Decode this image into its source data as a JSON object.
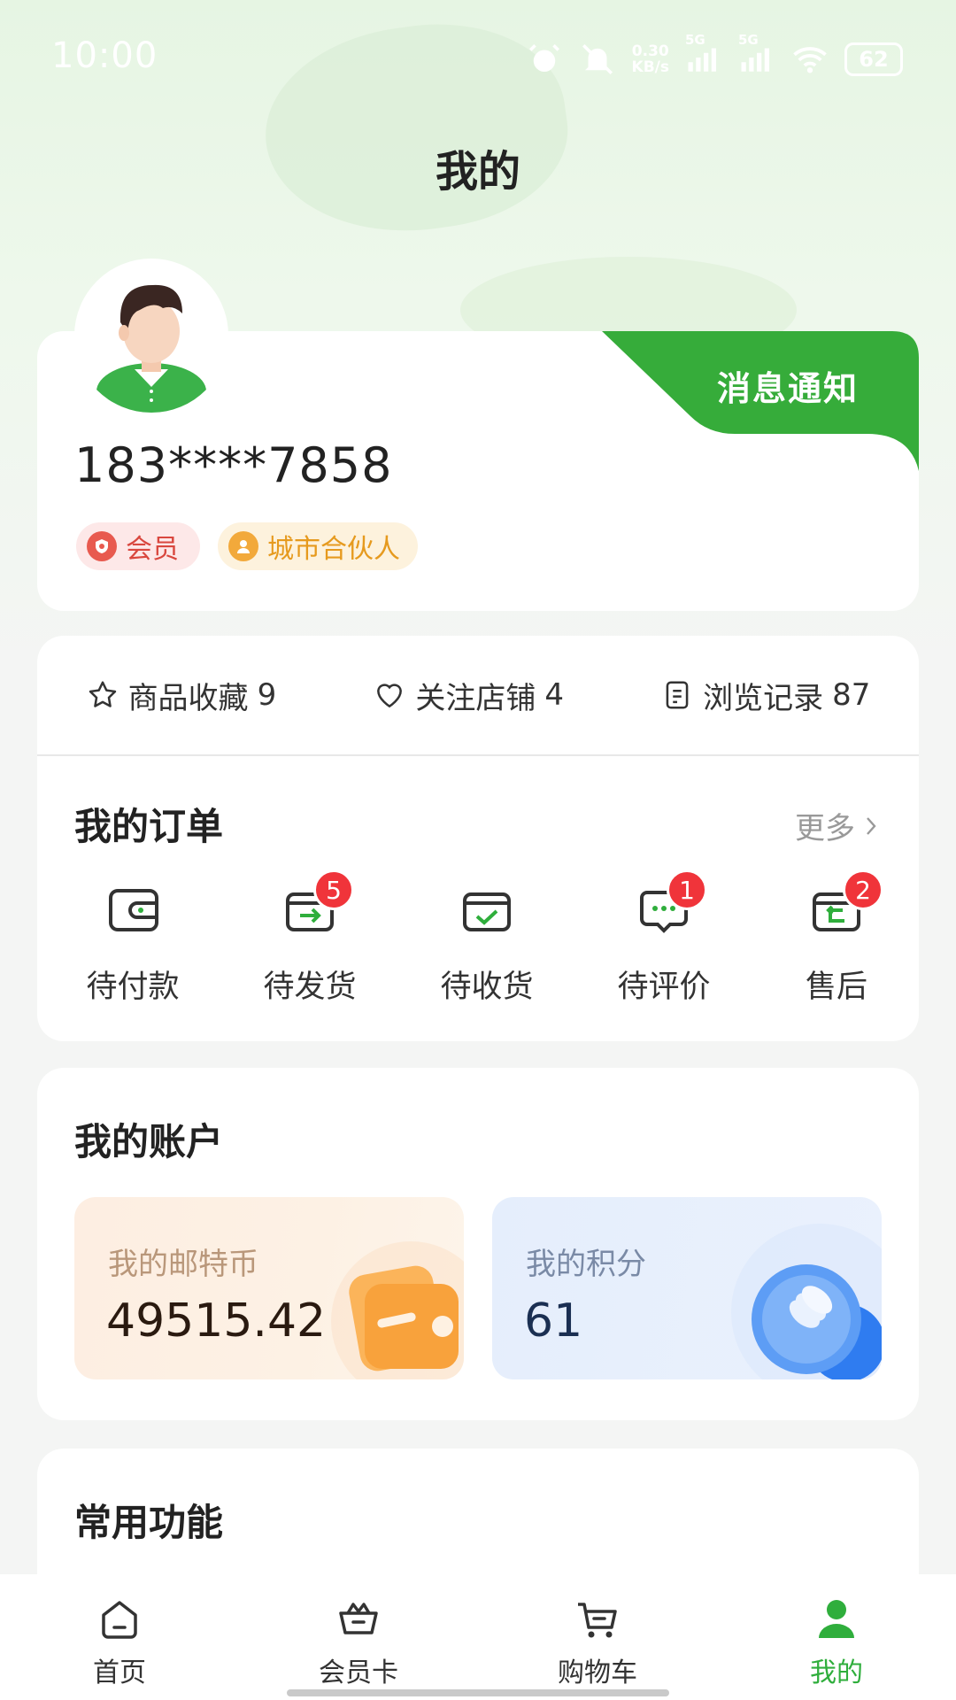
{
  "status_bar": {
    "time": "10:00",
    "net_speed_top": "0.30",
    "net_speed_bottom": "KB/s",
    "sim1": "5G",
    "sim2": "5G",
    "battery": "62"
  },
  "page": {
    "title": "我的"
  },
  "profile": {
    "phone": "183****7858",
    "notice_label": "消息通知",
    "badges": [
      {
        "label": "会员",
        "icon": "member-shield-icon",
        "color": "#e85a4f"
      },
      {
        "label": "城市合伙人",
        "icon": "partner-person-icon",
        "color": "#f2a93b"
      }
    ]
  },
  "stats": [
    {
      "label": "商品收藏",
      "count": "9",
      "icon": "star-icon"
    },
    {
      "label": "关注店铺",
      "count": "4",
      "icon": "heart-icon"
    },
    {
      "label": "浏览记录",
      "count": "87",
      "icon": "document-icon"
    }
  ],
  "orders": {
    "title": "我的订单",
    "more_label": "更多",
    "items": [
      {
        "label": "待付款",
        "icon": "wallet-icon",
        "badge": null
      },
      {
        "label": "待发货",
        "icon": "ship-box-icon",
        "badge": "5"
      },
      {
        "label": "待收货",
        "icon": "receive-box-icon",
        "badge": null
      },
      {
        "label": "待评价",
        "icon": "comment-icon",
        "badge": "1"
      },
      {
        "label": "售后",
        "icon": "after-sale-icon",
        "badge": "2"
      }
    ]
  },
  "account": {
    "title": "我的账户",
    "coin": {
      "label": "我的邮特币",
      "value": "49515.42"
    },
    "points": {
      "label": "我的积分",
      "value": "61"
    }
  },
  "functions": {
    "title": "常用功能"
  },
  "nav": [
    {
      "label": "首页",
      "icon": "home-icon",
      "active": false
    },
    {
      "label": "会员卡",
      "icon": "crown-basket-icon",
      "active": false
    },
    {
      "label": "购物车",
      "icon": "cart-icon",
      "active": false
    },
    {
      "label": "我的",
      "icon": "person-icon",
      "active": true
    }
  ],
  "colors": {
    "accent_green": "#2fae3c",
    "badge_red": "#f0343a",
    "coin_orange": "#f7a13b",
    "points_blue": "#3b82f6"
  }
}
